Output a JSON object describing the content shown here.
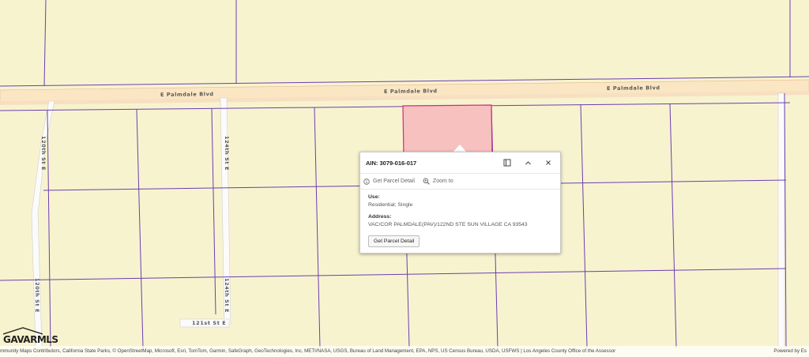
{
  "map": {
    "road_labels": {
      "palmdale_1": "E Palmdale Blvd",
      "palmdale_2": "E Palmdale Blvd",
      "palmdale_3": "E Palmdale Blvd",
      "st_120_top": "120th St E",
      "st_124_top": "124th St E",
      "st_120_bottom": "120th St E",
      "st_124_bottom": "124th St E",
      "st_121": "121st St E"
    },
    "colors": {
      "background": "#f8f3cf",
      "parcel_line": "#6a3fb0",
      "selected_parcel_fill": "#f6c1bf",
      "selected_parcel_outline": "#d62a7c",
      "road_fill": "#fbe6c4"
    }
  },
  "popup": {
    "title": "AIN: 3079-016-017",
    "actions": {
      "get_detail": "Get Parcel Detail",
      "zoom_to": "Zoom to"
    },
    "use_label": "Use:",
    "use_value": "Residential; Single",
    "address_label": "Address:",
    "address_value": "VAC/COR PALMDALE(PAV)/122ND STE SUN VILLAGE CA 93543",
    "detail_button": "Get Parcel Detail"
  },
  "attribution": {
    "text": "mmunity Maps Contributors, California State Parks, © OpenStreetMap, Microsoft, Esri, TomTom, Garmin, SafeGraph, GeoTechnologies, Inc, METI/NASA, USGS, Bureau of Land Management, EPA, NPS, US Census Bureau, USDA, USFWS | Los Angeles County Office of the Assessor",
    "powered": "Powered by Es"
  },
  "logo": {
    "text": "GAVARMLS"
  }
}
